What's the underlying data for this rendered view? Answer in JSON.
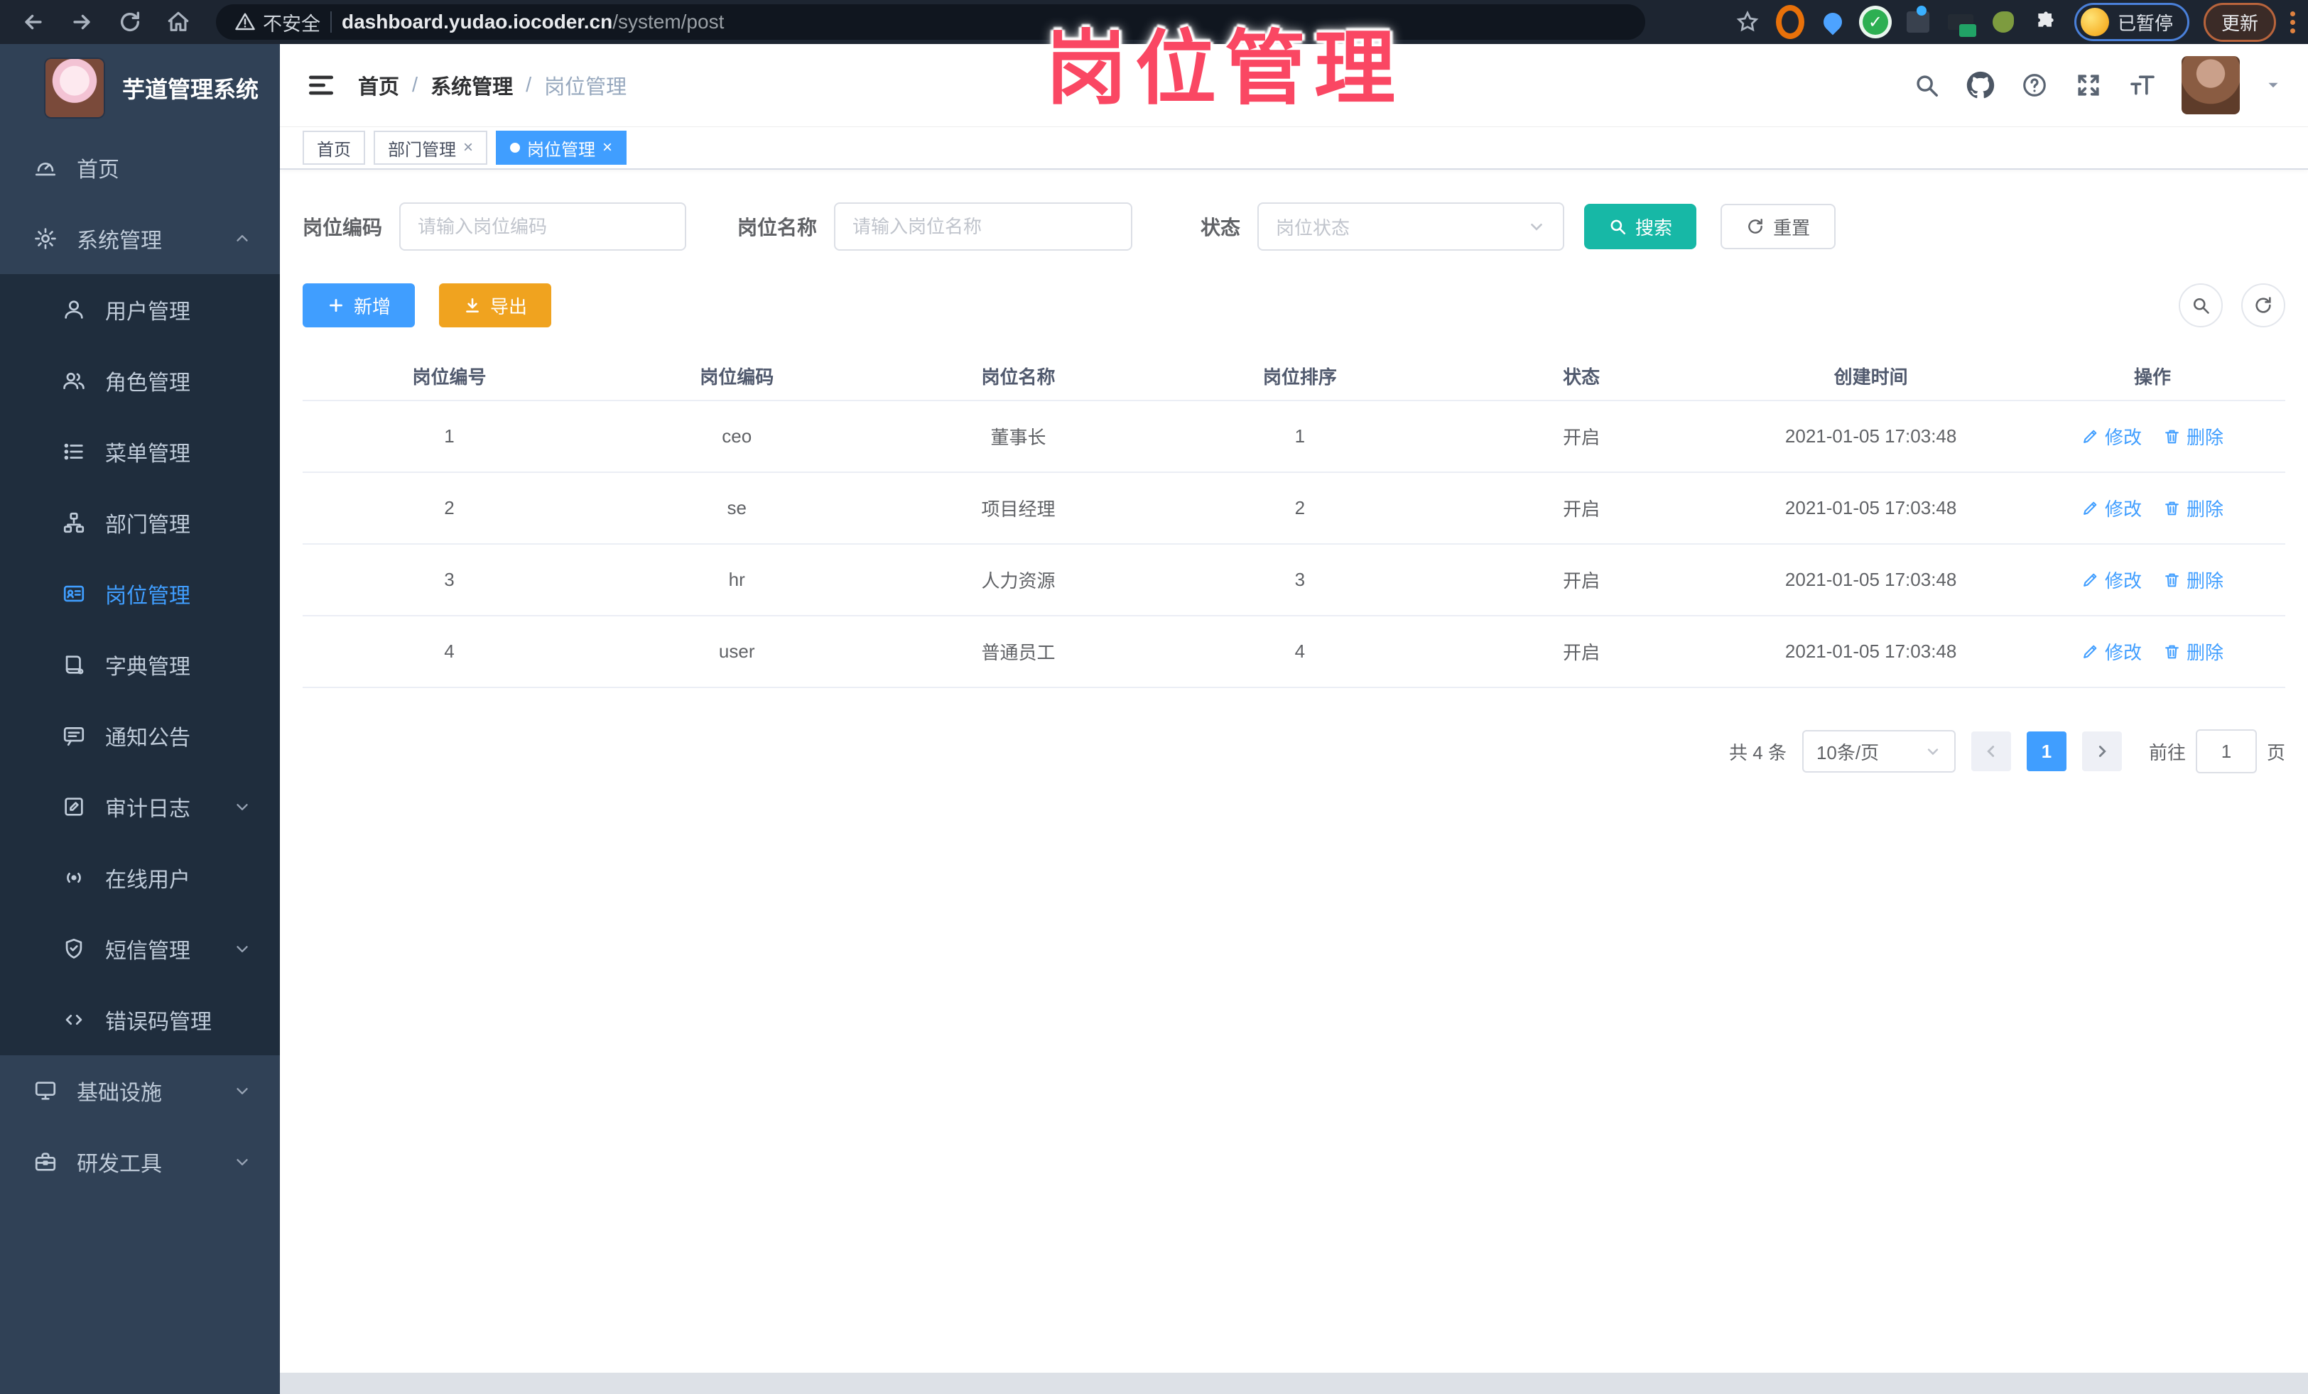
{
  "overlay_title": "岗位管理",
  "browser": {
    "security_label": "不安全",
    "url_host": "dashboard.yudao.iocoder.cn",
    "url_path": "/system/post",
    "paused_badge": "已暂停",
    "update_label": "更新"
  },
  "sidebar": {
    "app_title": "芋道管理系统",
    "items": [
      {
        "name": "home",
        "label": "首页",
        "icon": "dashboard",
        "level": 0
      },
      {
        "name": "system",
        "label": "系统管理",
        "icon": "gear",
        "level": 0,
        "caret": "up"
      },
      {
        "name": "user-mgmt",
        "label": "用户管理",
        "icon": "user",
        "level": 1
      },
      {
        "name": "role-mgmt",
        "label": "角色管理",
        "icon": "users",
        "level": 1
      },
      {
        "name": "menu-mgmt",
        "label": "菜单管理",
        "icon": "list",
        "level": 1
      },
      {
        "name": "dept-mgmt",
        "label": "部门管理",
        "icon": "tree",
        "level": 1
      },
      {
        "name": "post-mgmt",
        "label": "岗位管理",
        "icon": "idcard",
        "level": 1,
        "active": true
      },
      {
        "name": "dict-mgmt",
        "label": "字典管理",
        "icon": "book",
        "level": 1
      },
      {
        "name": "notice",
        "label": "通知公告",
        "icon": "bubble",
        "level": 1
      },
      {
        "name": "audit-log",
        "label": "审计日志",
        "icon": "log",
        "level": 1,
        "caret": "down"
      },
      {
        "name": "online-users",
        "label": "在线用户",
        "icon": "online",
        "level": 1
      },
      {
        "name": "sms-mgmt",
        "label": "短信管理",
        "icon": "shield",
        "level": 1,
        "caret": "down"
      },
      {
        "name": "error-code",
        "label": "错误码管理",
        "icon": "code",
        "level": 1
      },
      {
        "name": "infra",
        "label": "基础设施",
        "icon": "monitor",
        "level": 0,
        "caret": "down"
      },
      {
        "name": "devtools",
        "label": "研发工具",
        "icon": "toolbox",
        "level": 0,
        "caret": "down"
      }
    ]
  },
  "header": {
    "breadcrumb": [
      "首页",
      "系统管理",
      "岗位管理"
    ]
  },
  "tags": [
    {
      "label": "首页",
      "closable": false,
      "active": false
    },
    {
      "label": "部门管理",
      "closable": true,
      "active": false
    },
    {
      "label": "岗位管理",
      "closable": true,
      "active": true
    }
  ],
  "filters": {
    "code_label": "岗位编码",
    "code_placeholder": "请输入岗位编码",
    "name_label": "岗位名称",
    "name_placeholder": "请输入岗位名称",
    "status_label": "状态",
    "status_placeholder": "岗位状态",
    "search_label": "搜索",
    "reset_label": "重置"
  },
  "toolbar": {
    "add_label": "新增",
    "export_label": "导出"
  },
  "table": {
    "headers": [
      "岗位编号",
      "岗位编码",
      "岗位名称",
      "岗位排序",
      "状态",
      "创建时间",
      "操作"
    ],
    "edit_label": "修改",
    "delete_label": "删除",
    "rows": [
      {
        "id": "1",
        "code": "ceo",
        "name": "董事长",
        "sort": "1",
        "status": "开启",
        "created": "2021-01-05 17:03:48"
      },
      {
        "id": "2",
        "code": "se",
        "name": "项目经理",
        "sort": "2",
        "status": "开启",
        "created": "2021-01-05 17:03:48"
      },
      {
        "id": "3",
        "code": "hr",
        "name": "人力资源",
        "sort": "3",
        "status": "开启",
        "created": "2021-01-05 17:03:48"
      },
      {
        "id": "4",
        "code": "user",
        "name": "普通员工",
        "sort": "4",
        "status": "开启",
        "created": "2021-01-05 17:03:48"
      }
    ]
  },
  "pagination": {
    "total": "共 4 条",
    "page_size": "10条/页",
    "current": "1",
    "goto_label": "前往",
    "goto_value": "1",
    "page_unit": "页"
  },
  "colors": {
    "accent": "#409eff",
    "teal": "#17b8a6",
    "warning": "#f0a31f",
    "annotation": "#fa4763"
  }
}
